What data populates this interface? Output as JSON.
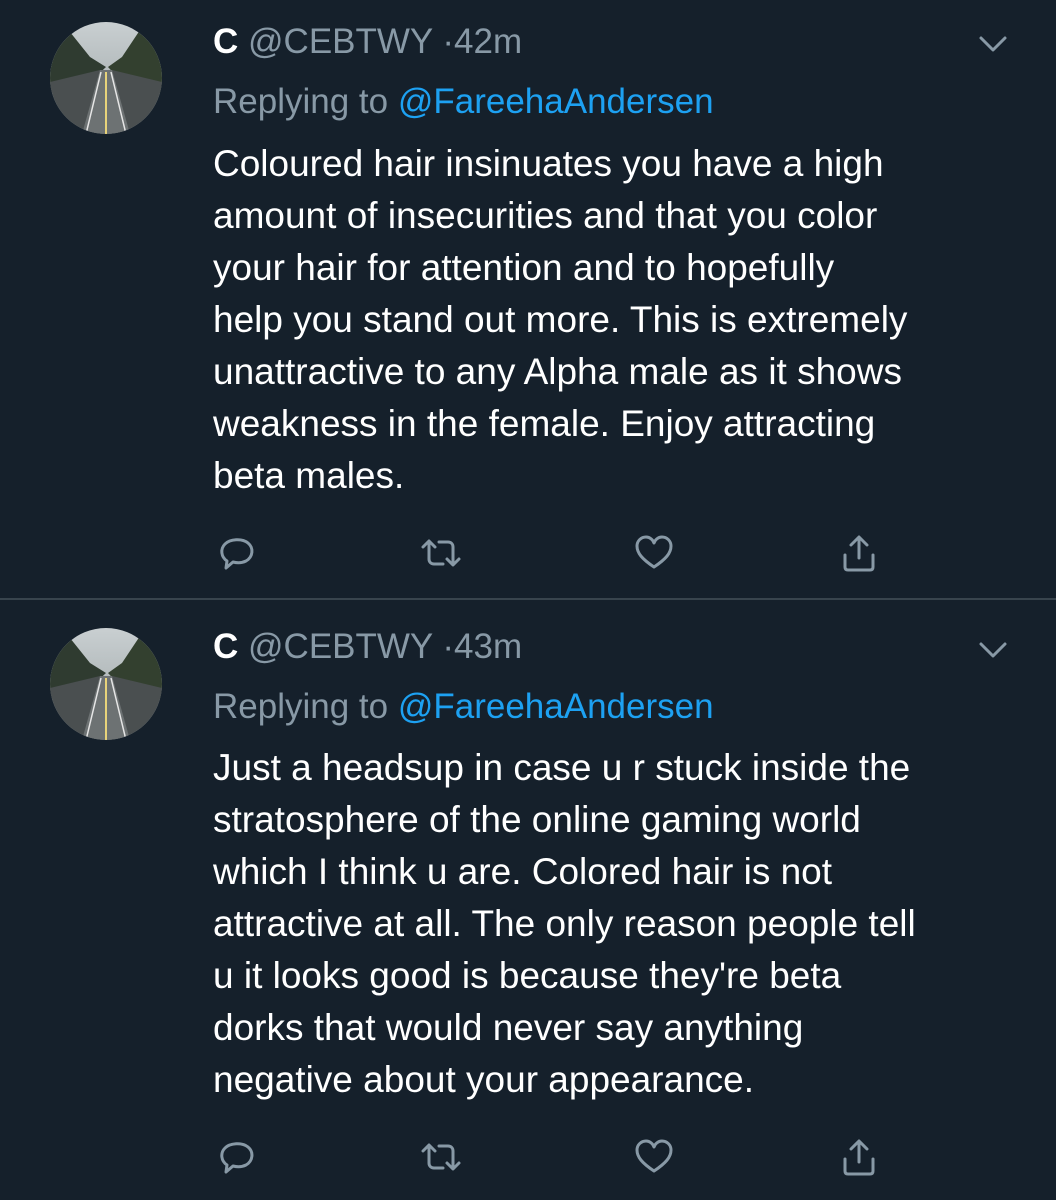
{
  "tweets": [
    {
      "display_name": "C",
      "handle": "@CEBTWY",
      "separator": "·",
      "time": "42m",
      "reply_prefix": "Replying to",
      "reply_handle": "@FareehaAndersen",
      "lines": [
        "Coloured hair insinuates you have a high",
        "amount of insecurities and that you color",
        "your hair for attention and to hopefully",
        "help you stand out more. This is extremely",
        "unattractive to any Alpha male as it shows",
        "weakness in the female. Enjoy attracting",
        "beta males."
      ]
    },
    {
      "display_name": "C",
      "handle": "@CEBTWY",
      "separator": "·",
      "time": "43m",
      "reply_prefix": "Replying to",
      "reply_handle": "@FareehaAndersen",
      "lines": [
        "Just a headsup in case u r stuck inside the",
        "stratosphere of the online gaming world",
        "which I think u are. Colored hair is not",
        "attractive at all. The only reason people tell",
        "u it looks good is because they're beta",
        "dorks that would never say anything",
        "negative about your appearance."
      ]
    }
  ],
  "icons": {
    "reply": "reply-icon",
    "retweet": "retweet-icon",
    "like": "heart-icon",
    "share": "share-icon",
    "menu": "chevron-down-icon"
  },
  "colors": {
    "background": "#15202b",
    "secondary_text": "#8899a6",
    "link": "#1da1f2",
    "divider": "#38444d"
  }
}
